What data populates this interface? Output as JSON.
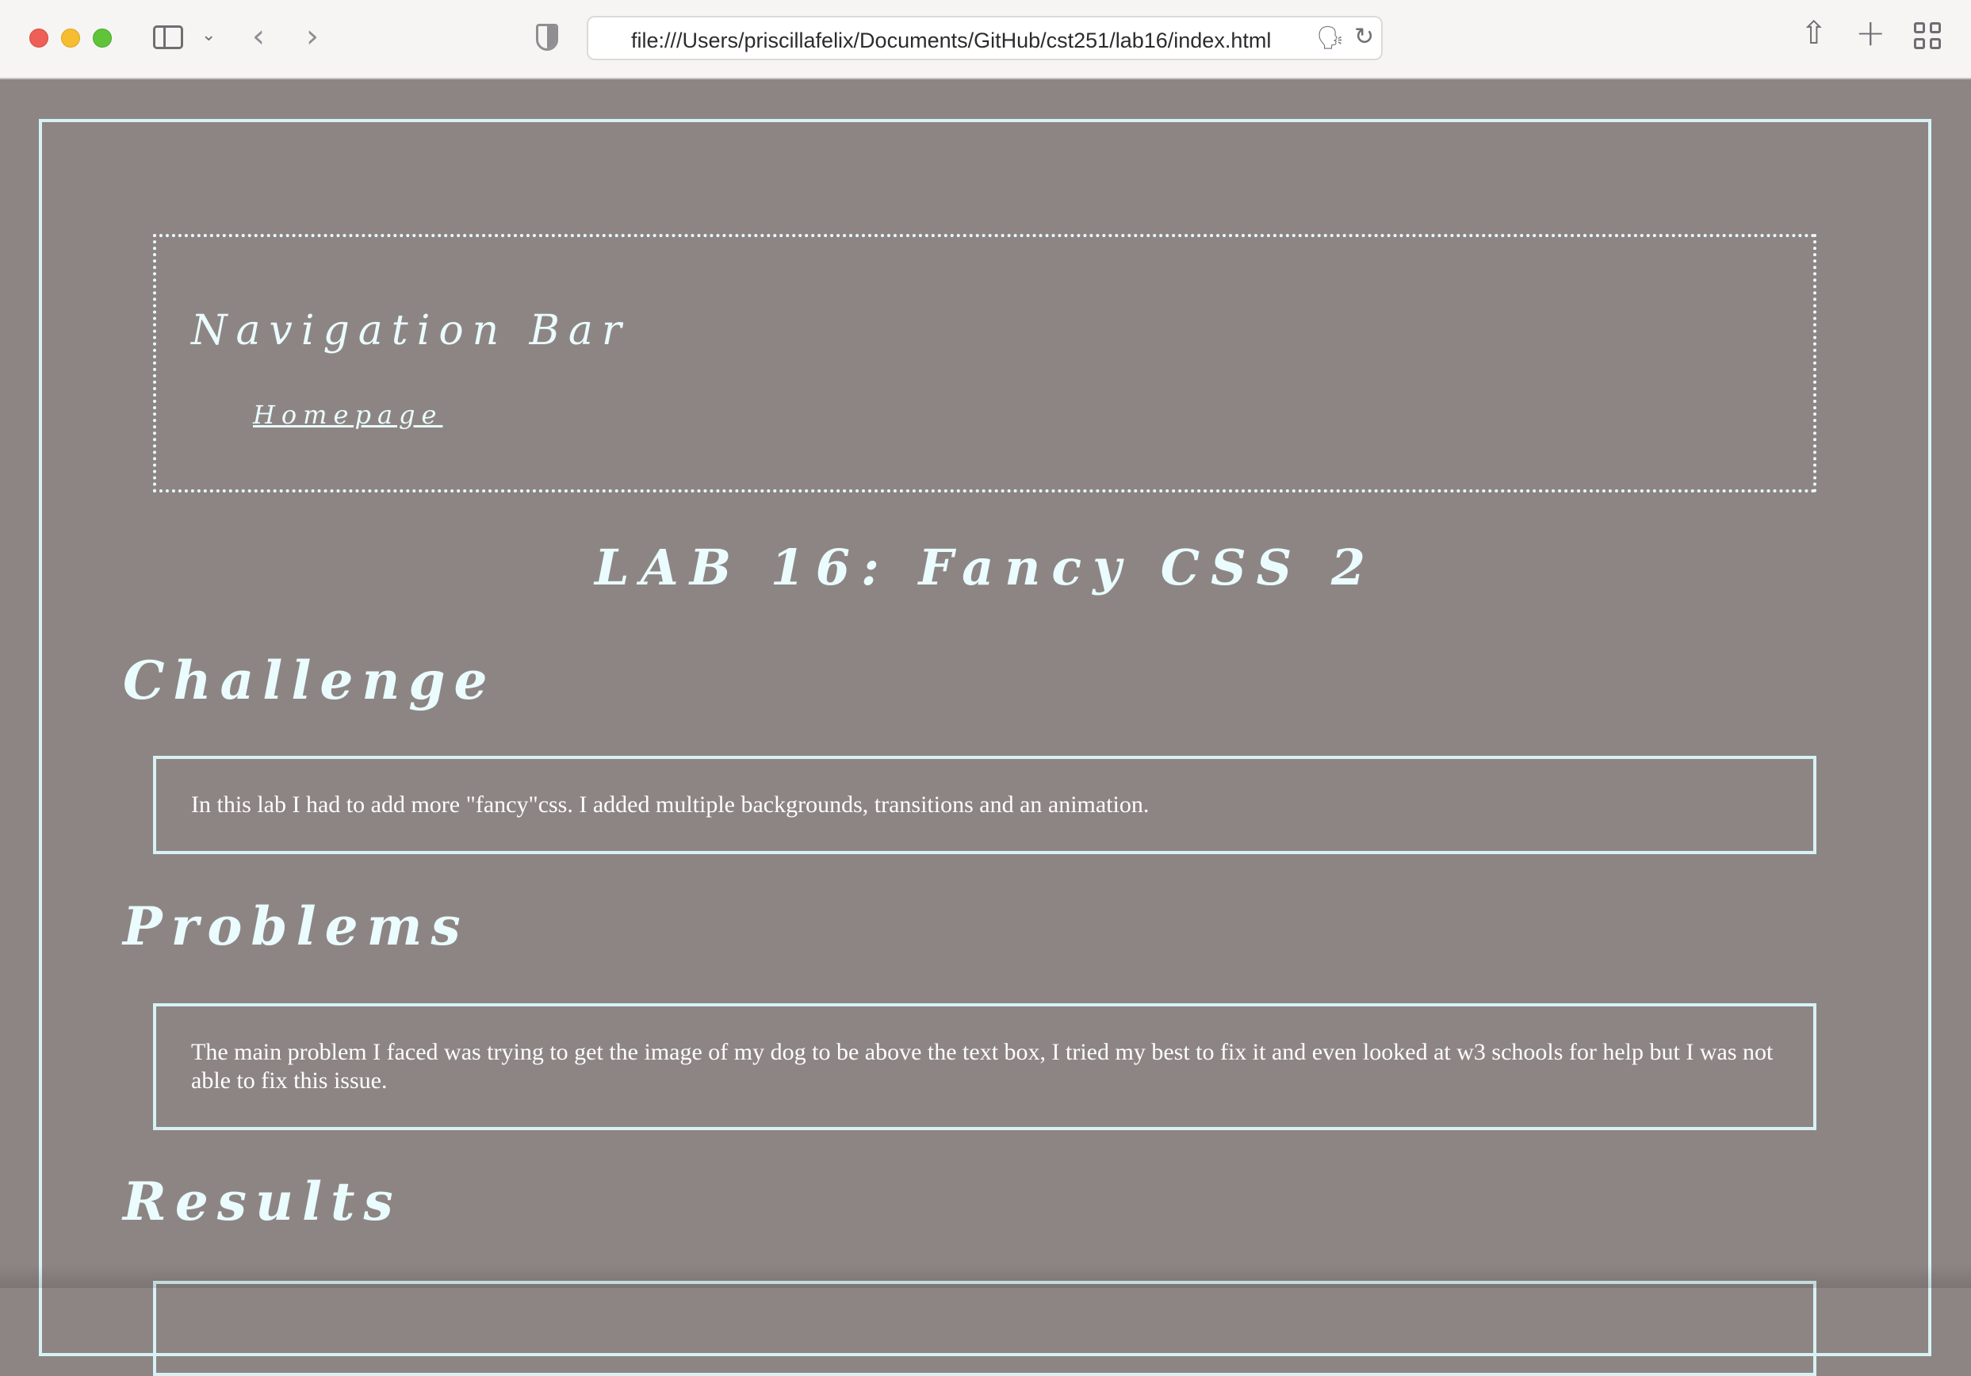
{
  "browser": {
    "url": "file:///Users/priscillafelix/Documents/GitHub/cst251/lab16/index.html",
    "icons": {
      "sidebar": "sidebar-icon",
      "sidebar_menu": "chevron-down-icon",
      "back": "chevron-left-icon",
      "forward": "chevron-right-icon",
      "privacy": "shield-icon",
      "translate": "translate-icon",
      "reload": "reload-icon",
      "share": "share-icon",
      "new_tab": "plus-icon",
      "tab_overview": "grid-icon"
    }
  },
  "page": {
    "nav": {
      "title": "Navigation Bar",
      "links": [
        "Homepage"
      ]
    },
    "title": "LAB 16: Fancy CSS 2",
    "sections": [
      {
        "heading": "Challenge",
        "body": "In this lab I had to add more \"fancy\"css. I added multiple backgrounds, transitions and an animation."
      },
      {
        "heading": "Problems",
        "body": "The main problem I faced was trying to get the image of my dog to be above the text box, I tried my best to fix it and even looked at w3 schools for help but I was not able to fix this issue."
      },
      {
        "heading": "Results",
        "body": ""
      }
    ]
  },
  "colors": {
    "background": "#8d8584",
    "border": "#d7f2f5",
    "heading_text": "#eafcfd",
    "body_text": "#ffffff"
  }
}
